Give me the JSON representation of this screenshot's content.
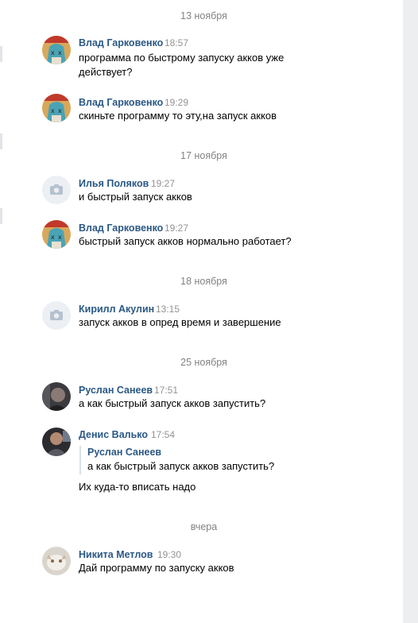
{
  "messages_history": {
    "groups": [
      {
        "date": "13 ноября",
        "messages": [
          {
            "author": "Влад Гарковенко",
            "time": "18:57",
            "text": "программа по быстрому запуску акков уже действует?",
            "avatar": "vlad-avatar"
          },
          {
            "author": "Влад Гарковенко",
            "time": "19:29",
            "text": "скиньте программу то эту,на запуск акков",
            "avatar": "vlad-avatar"
          }
        ]
      },
      {
        "date": "17 ноября",
        "messages": [
          {
            "author": "Илья Поляков",
            "time": "19:27",
            "text": "и быстрый запуск акков",
            "avatar": "camera-placeholder-icon"
          },
          {
            "author": "Влад Гарковенко",
            "time": "19:27",
            "text": "быстрый запуск акков нормально работает?",
            "avatar": "vlad-avatar"
          }
        ]
      },
      {
        "date": "18 ноября",
        "messages": [
          {
            "author": "Кирилл Акулин",
            "time": "13:15",
            "text": "запуск акков в опред время и завершение",
            "avatar": "camera-placeholder-icon"
          }
        ]
      },
      {
        "date": "25 ноября",
        "messages": [
          {
            "author": "Руслан Санеев",
            "time": "17:51",
            "text": "а как быстрый запуск акков запустить?",
            "avatar": "ruslan-avatar"
          },
          {
            "author": "Денис Валько",
            "time": "17:54",
            "avatar": "denis-avatar",
            "quote": {
              "author": "Руслан Санеев",
              "text": "а как быстрый запуск акков запустить?"
            },
            "text": "Их куда-то вписать надо"
          }
        ]
      },
      {
        "date": "вчера",
        "messages": [
          {
            "author": "Никита Метлов",
            "time": "19:30",
            "text": "Дай программу по запуску акков",
            "avatar": "nikita-avatar"
          }
        ]
      }
    ]
  },
  "colors": {
    "author": "#2a5885",
    "time": "#939393",
    "date_divider": "#828282",
    "quote_bar": "#dae1e8",
    "placeholder_bg": "#eceff3",
    "placeholder_icon": "#b5c1cf"
  }
}
